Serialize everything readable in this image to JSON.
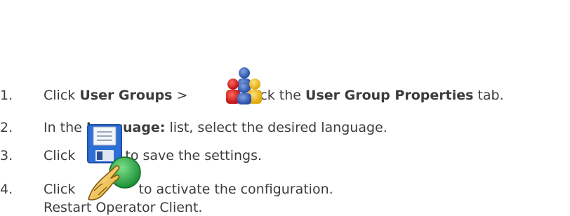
{
  "steps": [
    {
      "number": "1.",
      "t1": "Click ",
      "b1": "User Groups",
      "t2": " > ",
      "icon": "user-groups-icon",
      "t3": ". Click the ",
      "b2": "User Group Properties",
      "t4": " tab."
    },
    {
      "number": "2.",
      "t1": "In the ",
      "b1": "Language:",
      "t2": " list, select the desired language."
    },
    {
      "number": "3.",
      "t1": "Click ",
      "icon": "save-icon",
      "t2": " to save the settings."
    },
    {
      "number": "4.",
      "t1": "Click ",
      "icon": "activate-icon",
      "t2": " to activate the configuration.",
      "subline": "Restart Operator Client."
    }
  ]
}
